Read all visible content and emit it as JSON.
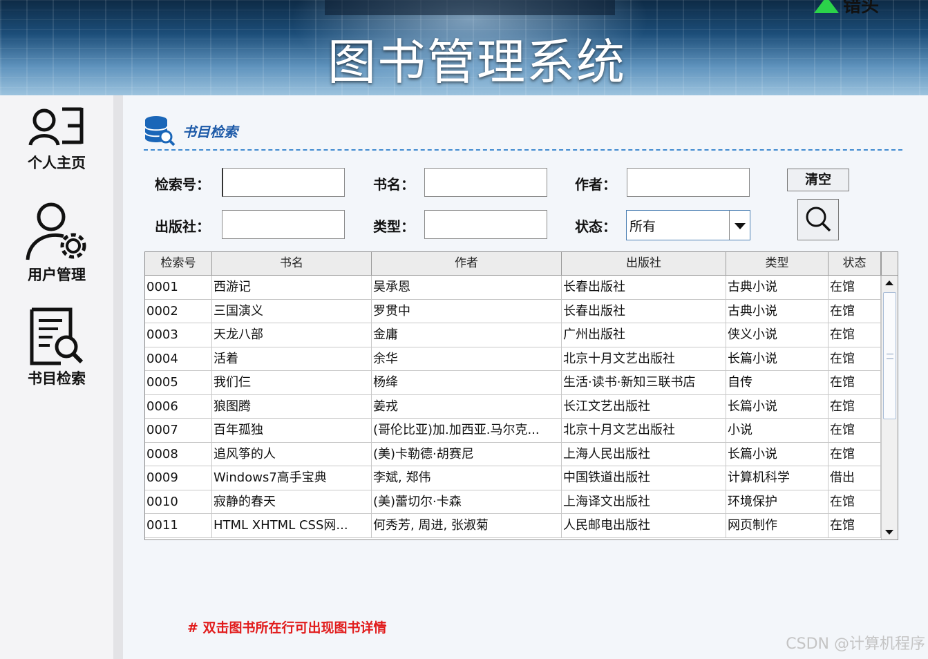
{
  "header": {
    "title": "图书管理系统",
    "exit_label": "错头"
  },
  "sidebar": {
    "items": [
      {
        "label": "个人主页",
        "icon": "user-profile-icon"
      },
      {
        "label": "用户管理",
        "icon": "user-settings-icon"
      },
      {
        "label": "书目检索",
        "icon": "document-search-icon"
      }
    ]
  },
  "section": {
    "title": "书目检索",
    "icon": "database-search-icon"
  },
  "form": {
    "code_label": "检索号：",
    "name_label": "书名：",
    "author_label": "作者：",
    "publisher_label": "出版社：",
    "type_label": "类型：",
    "status_label": "状态：",
    "code_value": "",
    "name_value": "",
    "author_value": "",
    "publisher_value": "",
    "type_value": "",
    "status_value": "所有",
    "clear_label": "清空"
  },
  "table": {
    "columns": [
      "检索号",
      "书名",
      "作者",
      "出版社",
      "类型",
      "状态"
    ],
    "rows": [
      [
        "0001",
        "西游记",
        "吴承恩",
        "长春出版社",
        "古典小说",
        "在馆"
      ],
      [
        "0002",
        "三国演义",
        "罗贯中",
        "长春出版社",
        "古典小说",
        "在馆"
      ],
      [
        "0003",
        "天龙八部",
        "金庸",
        "广州出版社",
        "侠义小说",
        "在馆"
      ],
      [
        "0004",
        "活着",
        "余华",
        "北京十月文艺出版社",
        "长篇小说",
        "在馆"
      ],
      [
        "0005",
        "我们仨",
        "杨绛",
        "生活·读书·新知三联书店",
        "自传",
        "在馆"
      ],
      [
        "0006",
        "狼图腾",
        "姜戎",
        "长江文艺出版社",
        "长篇小说",
        "在馆"
      ],
      [
        "0007",
        "百年孤独",
        "(哥伦比亚)加.加西亚.马尔克...",
        "北京十月文艺出版社",
        "小说",
        "在馆"
      ],
      [
        "0008",
        "追风筝的人",
        "(美)卡勒德·胡赛尼",
        "上海人民出版社",
        "长篇小说",
        "在馆"
      ],
      [
        "0009",
        "Windows7高手宝典",
        "李斌, 郑伟",
        "中国铁道出版社",
        "计算机科学",
        "借出"
      ],
      [
        "0010",
        "寂静的春天",
        "(美)蕾切尔·卡森",
        "上海译文出版社",
        "环境保护",
        "在馆"
      ],
      [
        "0011",
        "HTML XHTML CSS网...",
        "何秀芳, 周进, 张淑菊",
        "人民邮电出版社",
        "网页制作",
        "在馆"
      ]
    ]
  },
  "hint": "# 双击图书所在行可出现图书详情",
  "watermark": "CSDN @计算机程序"
}
